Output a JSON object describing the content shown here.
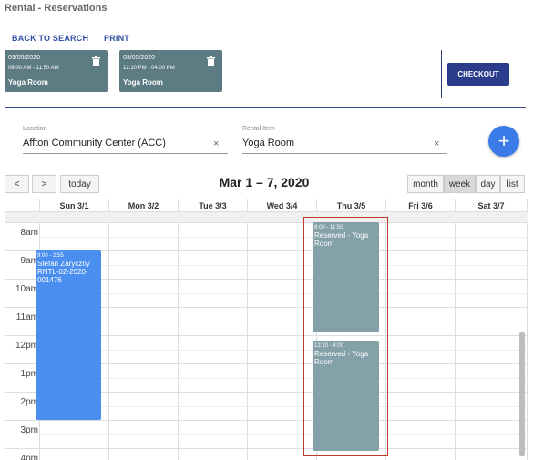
{
  "page_title": "Rental - Reservations",
  "nav": {
    "back_label": "BACK TO SEARCH",
    "print_label": "PRINT"
  },
  "cards": [
    {
      "date": "03/05/2020",
      "time": "08:00 AM - 11:50 AM",
      "room": "Yoga Room"
    },
    {
      "date": "03/05/2020",
      "time": "12:10 PM - 04:00 PM",
      "room": "Yoga Room"
    }
  ],
  "checkout_label": "CHECKOUT",
  "location": {
    "label": "Location",
    "value": "Affton Community Center (ACC)",
    "clear": "×"
  },
  "rental_item": {
    "label": "Rental Item",
    "value": "Yoga Room",
    "clear": "×"
  },
  "add_label": "+",
  "toolbar": {
    "prev": "<",
    "next": ">",
    "today": "today",
    "range": "Mar 1 – 7, 2020",
    "views": [
      "month",
      "week",
      "day",
      "list"
    ],
    "active_view": "week"
  },
  "days": [
    "Sun 3/1",
    "Mon 3/2",
    "Tue 3/3",
    "Wed 3/4",
    "Thu 3/5",
    "Fri 3/6",
    "Sat 3/7"
  ],
  "times": [
    "8am",
    "9am",
    "10am",
    "11am",
    "12pm",
    "1pm",
    "2pm",
    "3pm",
    "4pm"
  ],
  "events": [
    {
      "day": "Sun 3/1",
      "time": "9:00 - 2:55",
      "title": "Stefan Zaryczny RNTL-02-2020-001476",
      "color": "#4a8ff0"
    },
    {
      "day": "Thu 3/5",
      "time": "8:00 - 11:50",
      "title": "Reserved - Yoga Room",
      "color": "#84a0a8"
    },
    {
      "day": "Thu 3/5",
      "time": "12:10 - 4:00",
      "title": "Reserved - Yoga Room",
      "color": "#84a0a8"
    }
  ]
}
